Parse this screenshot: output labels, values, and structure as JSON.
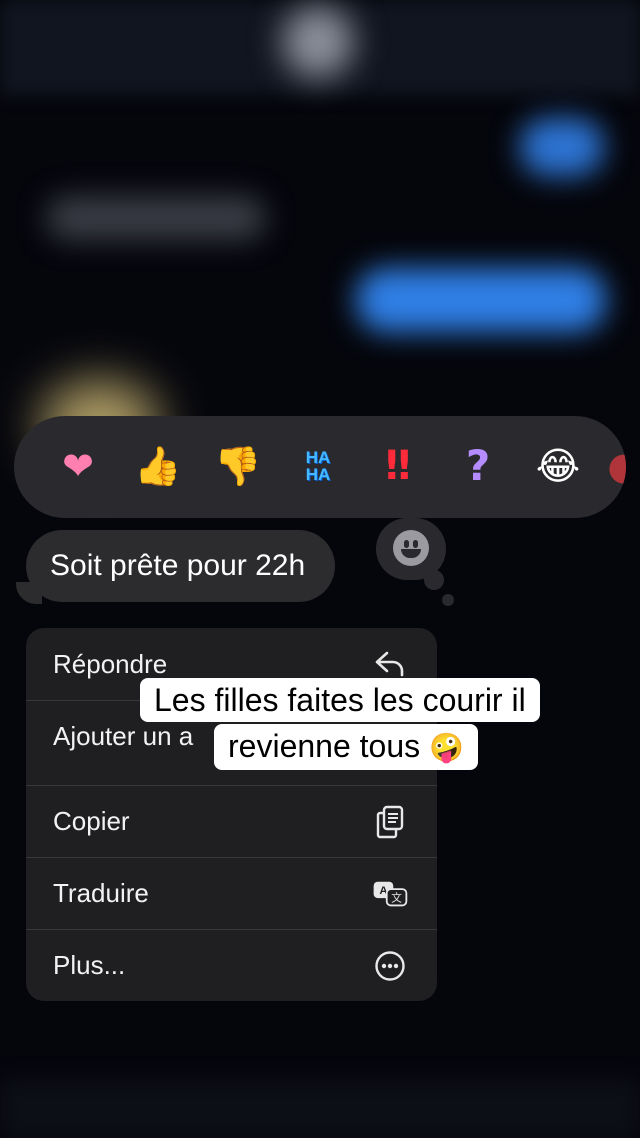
{
  "reactions": [
    {
      "name": "heart",
      "glyph": "❤"
    },
    {
      "name": "thumbs-up",
      "glyph": "👍"
    },
    {
      "name": "thumbs-down",
      "glyph": "👎"
    },
    {
      "name": "haha",
      "line1": "HA",
      "line2": "HA"
    },
    {
      "name": "exclamation",
      "glyph": "‼"
    },
    {
      "name": "question",
      "glyph": "?"
    },
    {
      "name": "laughing",
      "glyph": "😂"
    }
  ],
  "message": {
    "text": "Soit prête pour 22h"
  },
  "menu": {
    "items": [
      {
        "label": "Répondre",
        "icon": "reply-icon"
      },
      {
        "label": "Ajouter un a",
        "icon": "sticker-icon"
      },
      {
        "label": "Copier",
        "icon": "copy-icon"
      },
      {
        "label": "Traduire",
        "icon": "translate-icon"
      },
      {
        "label": "Plus...",
        "icon": "more-icon"
      }
    ]
  },
  "caption": {
    "line1": "Les filles faites les courir il",
    "line2": "revienne tous",
    "emoji": "🤪"
  },
  "colors": {
    "background": "#05060c",
    "panel": "#2a2a2e",
    "menu": "#1f1f22",
    "accent_blue": "#2f7fe6"
  }
}
